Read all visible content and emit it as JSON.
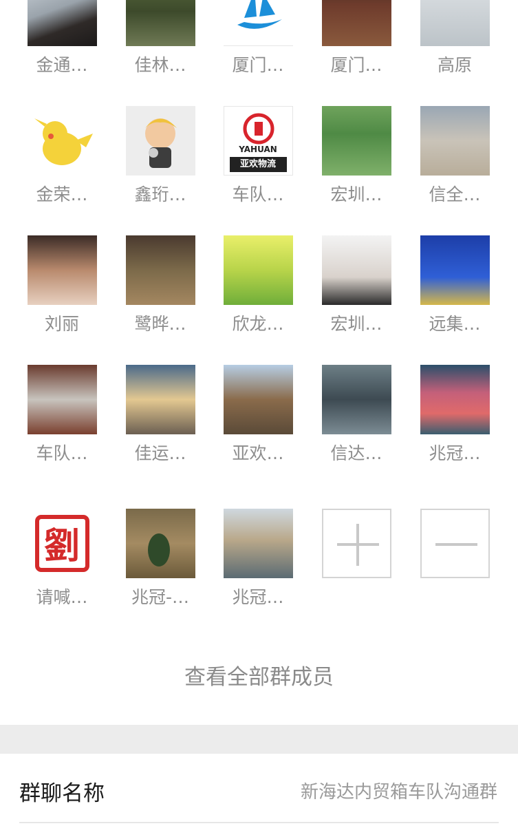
{
  "members": [
    {
      "name": "金通…",
      "avatar": "person-photo"
    },
    {
      "name": "佳林…",
      "avatar": "plants-photo"
    },
    {
      "name": "厦门…",
      "avatar": "ship-logo"
    },
    {
      "name": "厦门…",
      "avatar": "group-photo"
    },
    {
      "name": "高原",
      "avatar": "baby-photo"
    },
    {
      "name": "金荣…",
      "avatar": "pikachu-image"
    },
    {
      "name": "鑫珩…",
      "avatar": "cartoon-image"
    },
    {
      "name": "车队…",
      "avatar": "yahuan-logo",
      "logo_text": "YAHUAN",
      "logo_text_cn": "亚欢物流"
    },
    {
      "name": "宏圳…",
      "avatar": "flowers-photo"
    },
    {
      "name": "信全…",
      "avatar": "child-photo"
    },
    {
      "name": "刘丽",
      "avatar": "person-photo"
    },
    {
      "name": "鹭晔…",
      "avatar": "person-photo"
    },
    {
      "name": "欣龙…",
      "avatar": "child-flowers-photo"
    },
    {
      "name": "宏圳…",
      "avatar": "selfie-photo"
    },
    {
      "name": "远集…",
      "avatar": "golden-statue-photo"
    },
    {
      "name": "车队…",
      "avatar": "office-photo"
    },
    {
      "name": "佳运…",
      "avatar": "sunset-silhouette-photo"
    },
    {
      "name": "亚欢…",
      "avatar": "dog-glasses-photo"
    },
    {
      "name": "信达…",
      "avatar": "car-selfie-photo"
    },
    {
      "name": "兆冠…",
      "avatar": "red-tree-painting"
    },
    {
      "name": "请喊…",
      "avatar": "seal-stamp",
      "seal_char": "劉"
    },
    {
      "name": "兆冠-…",
      "avatar": "melon-photo"
    },
    {
      "name": "兆冠…",
      "avatar": "city-photo"
    }
  ],
  "add_member": {
    "icon": "plus-icon"
  },
  "remove_member": {
    "icon": "minus-icon"
  },
  "view_all_label": "查看全部群成员",
  "group_name_row": {
    "label": "群聊名称",
    "value": "新海达内贸箱车队沟通群"
  }
}
